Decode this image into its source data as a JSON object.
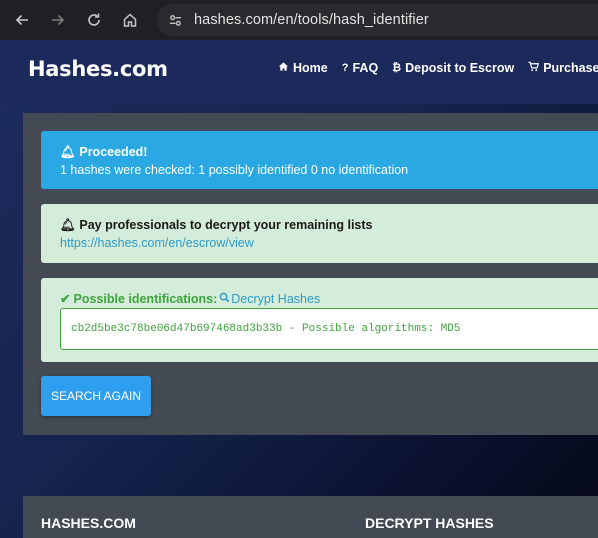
{
  "browser": {
    "url": "hashes.com/en/tools/hash_identifier"
  },
  "header": {
    "logo": "Hashes.com",
    "nav": [
      {
        "icon": "home-icon",
        "label": "Home"
      },
      {
        "icon": "question-icon",
        "label": "FAQ"
      },
      {
        "icon": "bitcoin-icon",
        "label": "Deposit to Escrow"
      },
      {
        "icon": "cart-icon",
        "label": "Purchase Cre"
      }
    ]
  },
  "alerts": {
    "info": {
      "title": "Proceeded!",
      "text": "1 hashes were checked: 1 possibly identified 0 no identification"
    },
    "escrow": {
      "title": "Pay professionals to decrypt your remaining lists",
      "link": "https://hashes.com/en/escrow/view"
    },
    "result": {
      "label": "Possible identifications:",
      "link": "Decrypt Hashes",
      "value": "cb2d5be3c78be06d47b697468ad3b33b - Possible algorithms: MD5"
    }
  },
  "actions": {
    "search_again": "SEARCH AGAIN"
  },
  "footer": {
    "col1": "HASHES.COM",
    "col2": "DECRYPT HASHES"
  },
  "colors": {
    "info": "#29a8e3",
    "success_bg": "#d4ecda",
    "success_text": "#3ea43e",
    "button": "#2d9ef0",
    "panel": "#434a54"
  }
}
